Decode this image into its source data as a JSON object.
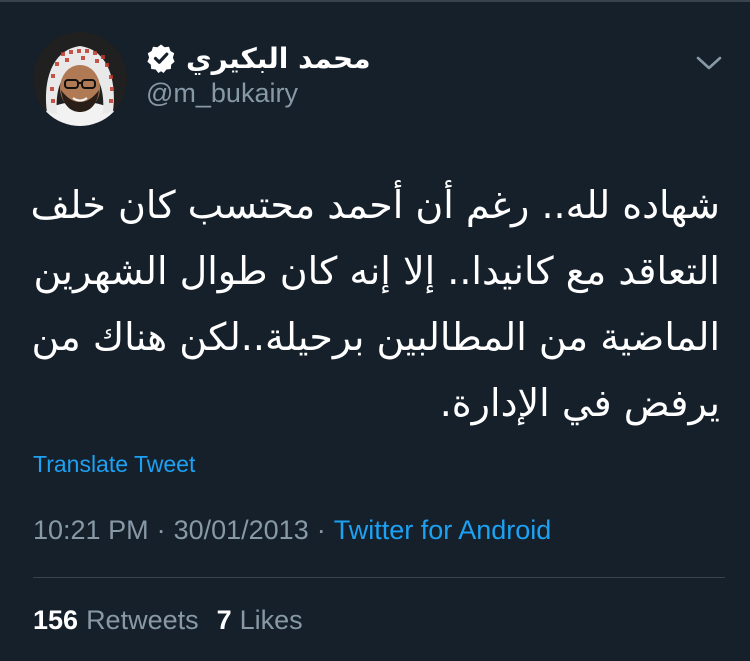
{
  "author": {
    "display_name": "محمد البكيري",
    "handle": "@m_bukairy",
    "avatar_icon": "profile-photo",
    "verified_icon": "verified-badge-icon"
  },
  "tweet": {
    "text": "شهاده لله.. رغم أن أحمد محتسب كان خلف التعاقد مع كانيدا.. إلا إنه كان طوال الشهرين الماضية من المطالبين برحيلة..لكن هناك من يرفض في الإدارة.",
    "translate_label": "Translate Tweet",
    "time": "10:21 PM",
    "date": "30/01/2013",
    "source": "Twitter for Android",
    "separator": "·"
  },
  "stats": {
    "retweets_count": "156",
    "retweets_label": "Retweets",
    "likes_count": "7",
    "likes_label": "Likes"
  },
  "colors": {
    "background": "#15202b",
    "accent": "#1da1f2",
    "secondary_text": "#8899a6",
    "divider": "#38444d"
  }
}
